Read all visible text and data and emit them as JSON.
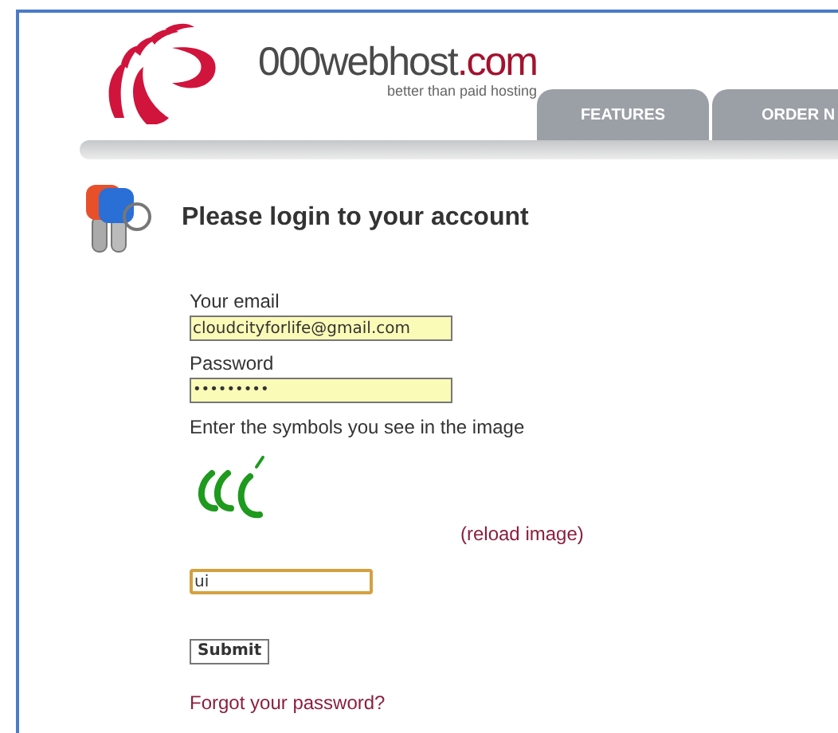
{
  "header": {
    "logo_text": "000webhost",
    "logo_domain": ".com",
    "tagline": "better than paid hosting"
  },
  "nav": {
    "tabs": [
      {
        "label": "FEATURES",
        "selected": false
      },
      {
        "label": "ORDER N",
        "selected": false
      }
    ]
  },
  "login": {
    "heading": "Please login to your account",
    "email": {
      "label": "Your email",
      "value": "cloudcityforlife@gmail.com"
    },
    "password": {
      "label": "Password",
      "value": "•••••••••"
    },
    "captcha": {
      "instruction": "Enter the symbols you see in the image",
      "reload": "(reload image)",
      "value": "ui"
    },
    "submit": "Submit",
    "forgot": "Forgot your password?"
  }
}
